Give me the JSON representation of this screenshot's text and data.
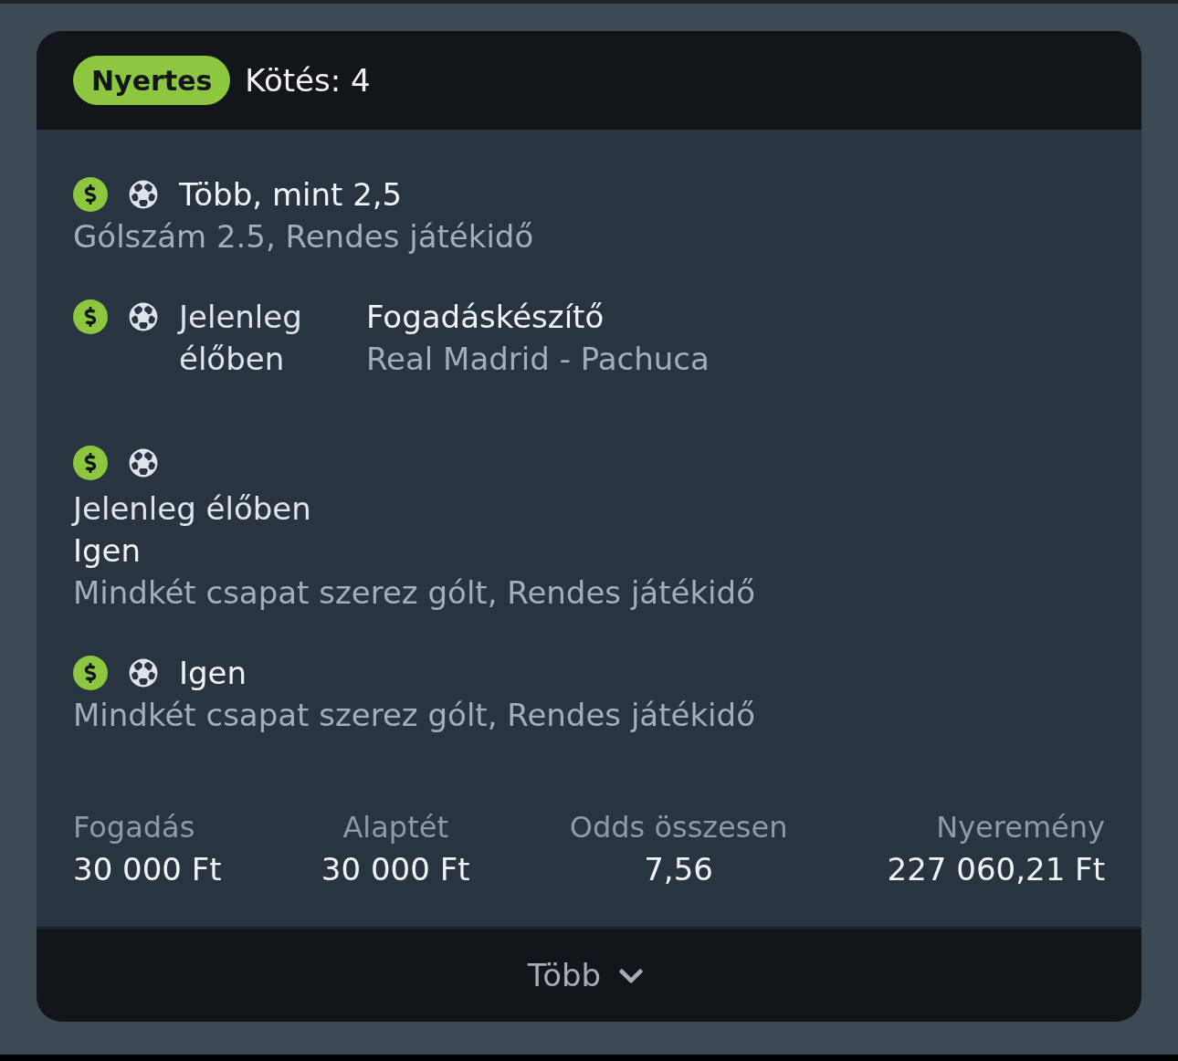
{
  "header": {
    "status_badge": "Nyertes",
    "bet_count": "Kötés: 4"
  },
  "selections": [
    {
      "kind": "inline",
      "title": "Több, mint 2,5",
      "market": "Gólszám 2.5, Rendes játékidő"
    },
    {
      "kind": "split",
      "status": "Jelenleg élőben",
      "title": "Fogadáskészítő",
      "market": "Real Madrid - Pachuca"
    },
    {
      "kind": "stacked",
      "status": "Jelenleg élőben",
      "title": "Igen",
      "market": "Mindkét csapat szerez gólt, Rendes játékidő"
    },
    {
      "kind": "inline",
      "title": "Igen",
      "market": "Mindkét csapat szerez gólt, Rendes játékidő"
    }
  ],
  "stats": [
    {
      "label": "Fogadás",
      "value": "30 000 Ft"
    },
    {
      "label": "Alaptét",
      "value": "30 000 Ft"
    },
    {
      "label": "Odds összesen",
      "value": "7,56"
    },
    {
      "label": "Nyeremény",
      "value": "227 060,21 Ft"
    }
  ],
  "footer": {
    "more_button": "Több"
  }
}
